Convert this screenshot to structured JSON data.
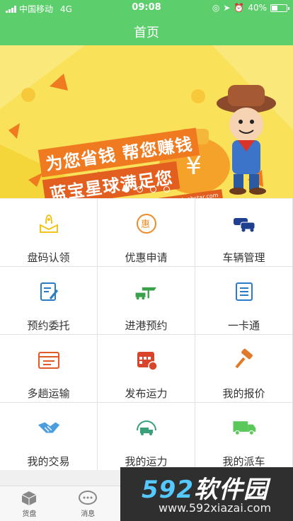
{
  "status_bar": {
    "carrier": "中国移动",
    "network": "4G",
    "time": "09:08",
    "battery": "40%",
    "battery_level": 0.4
  },
  "header": {
    "title": "首页"
  },
  "banner": {
    "line1": "为您省钱 帮您赚钱",
    "line2": "蓝宝星球满足您",
    "url_text": "让您收益蓝宝星球www.lanbstar.com",
    "slides": 4,
    "active_slide": 0
  },
  "grid": {
    "items": [
      {
        "label": "盘码认领",
        "icon": "box-hand-icon",
        "color": "#f0c419"
      },
      {
        "label": "优惠申请",
        "icon": "discount-icon",
        "color": "#f08a24"
      },
      {
        "label": "车辆管理",
        "icon": "cars-icon",
        "color": "#1f3f8f"
      },
      {
        "label": "预约委托",
        "icon": "edit-doc-icon",
        "color": "#2a7cc7"
      },
      {
        "label": "进港预约",
        "icon": "port-truck-icon",
        "color": "#3aa04a"
      },
      {
        "label": "一卡通",
        "icon": "card-list-icon",
        "color": "#2a7cc7"
      },
      {
        "label": "多趟运输",
        "icon": "schedule-icon",
        "color": "#e05a2a"
      },
      {
        "label": "发布运力",
        "icon": "calendar-publish-icon",
        "color": "#d9452b"
      },
      {
        "label": "我的报价",
        "icon": "gavel-icon",
        "color": "#e07a2a"
      },
      {
        "label": "我的交易",
        "icon": "handshake-icon",
        "color": "#4a9ee0"
      },
      {
        "label": "我的运力",
        "icon": "truck-speed-icon",
        "color": "#3aa07a"
      },
      {
        "label": "我的派车",
        "icon": "truck-icon",
        "color": "#5ac85a"
      }
    ]
  },
  "tabbar": {
    "items": [
      {
        "label": "货盘",
        "icon": "cube-icon"
      },
      {
        "label": "消息",
        "icon": "chat-icon"
      },
      {
        "label": "",
        "icon": "home-icon"
      },
      {
        "label": "",
        "icon": "doc-icon"
      },
      {
        "label": "",
        "icon": "user-icon"
      }
    ]
  },
  "watermark": {
    "big_num": "592",
    "big_text": "软件园",
    "small": "www.592xiazai.com"
  },
  "colors": {
    "primary": "#5ccf6c",
    "banner_bg": "#f9e15a"
  }
}
